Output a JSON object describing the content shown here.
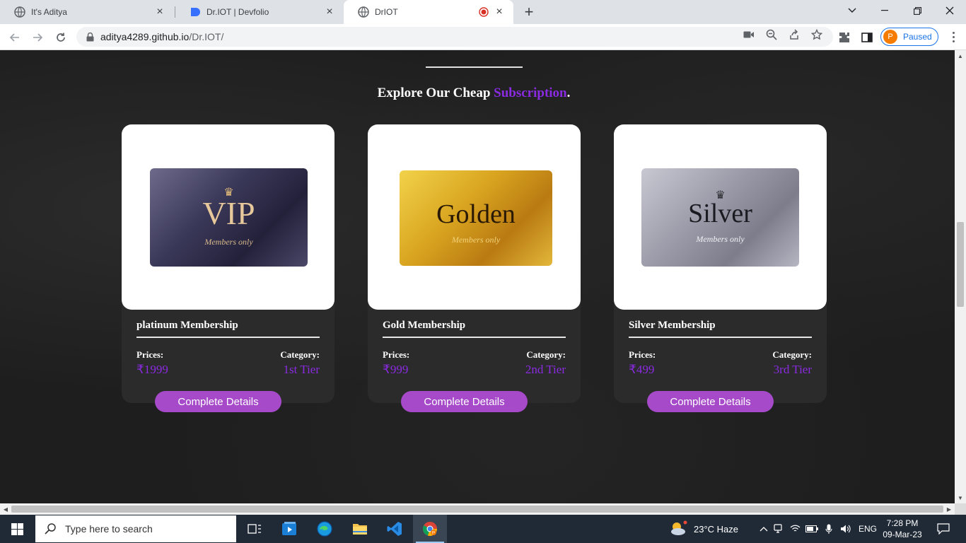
{
  "browser": {
    "tabs": [
      {
        "title": "It's Aditya",
        "icon": "globe-icon"
      },
      {
        "title": "Dr.IOT | Devfolio",
        "icon": "devfolio-icon"
      },
      {
        "title": "DrIOT",
        "icon": "globe-icon",
        "active": true
      }
    ],
    "url_host": "aditya4289.github.io",
    "url_path": "/Dr.IOT/",
    "profile_initial": "P",
    "profile_status": "Paused"
  },
  "page": {
    "heading_main": "Explore Our Cheap ",
    "heading_accent": "Subscription",
    "heading_end": ".",
    "accent_color": "#8a2be2",
    "button_color": "#a64ac9",
    "cards": [
      {
        "card_word": "VIP",
        "card_sub": "Members only",
        "name": "platinum Membership",
        "prices_label": "Prices:",
        "price": "₹1999",
        "category_label": "Category:",
        "category": "1st Tier",
        "button": "Complete Details"
      },
      {
        "card_word": "Golden",
        "card_sub": "Members only",
        "name": "Gold Membership",
        "prices_label": "Prices:",
        "price": "₹999",
        "category_label": "Category:",
        "category": "2nd Tier",
        "button": "Complete Details"
      },
      {
        "card_word": "Silver",
        "card_sub": "Members only",
        "name": "Silver Membership",
        "prices_label": "Prices:",
        "price": "₹499",
        "category_label": "Category:",
        "category": "3rd Tier",
        "button": "Complete Details"
      }
    ]
  },
  "taskbar": {
    "search_placeholder": "Type here to search",
    "weather": "23°C  Haze",
    "language": "ENG",
    "time": "7:28 PM",
    "date": "09-Mar-23"
  }
}
